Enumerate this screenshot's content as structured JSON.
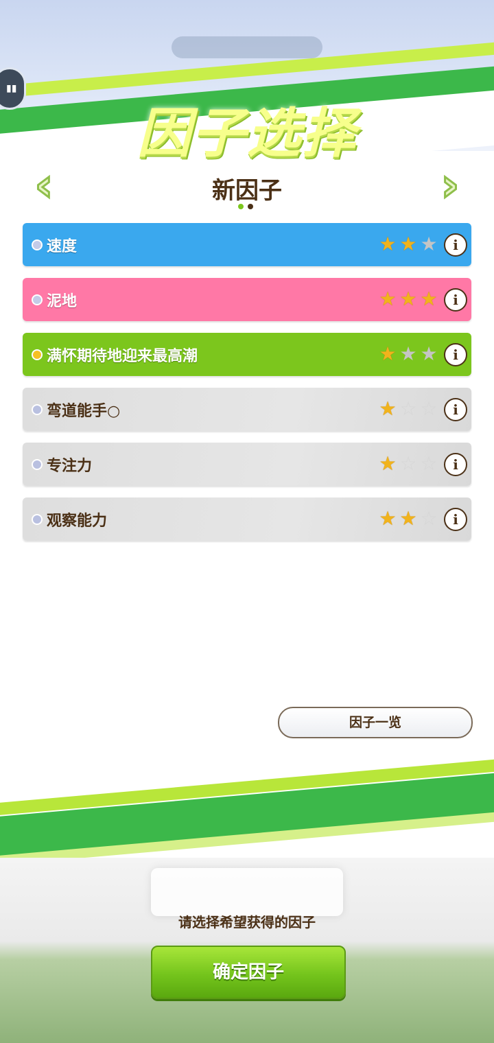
{
  "status_pill": "",
  "header": {
    "title": "因子选择",
    "subtitle": "新因子",
    "prev_arrow": "‹",
    "next_arrow": "›",
    "page_dots": [
      {
        "active": true
      },
      {
        "active": false
      }
    ]
  },
  "colors": {
    "brand_green": "#7cc61d",
    "text_brown": "#4b3016",
    "row_speed": "#3aa8ee",
    "row_dirt": "#ff78a6",
    "row_unique": "#7cc61d",
    "row_skill": "#dedede"
  },
  "factors": [
    {
      "name": "速度",
      "type": "blue",
      "stars": 2,
      "max_stars": 3,
      "bullet": "#c4cbe8",
      "bg": "#3aa8ee",
      "text_color": "#ffffff",
      "empty_style": "solid"
    },
    {
      "name": "泥地",
      "type": "pink",
      "stars": 3,
      "max_stars": 3,
      "bullet": "#c4cbe8",
      "bg": "#ff78a6",
      "text_color": "#ffffff",
      "empty_style": "solid"
    },
    {
      "name": "满怀期待地迎来最高潮",
      "type": "green",
      "stars": 1,
      "max_stars": 3,
      "bullet": "#f6c023",
      "bg": "#7cc61d",
      "text_color": "#ffffff",
      "empty_style": "solid"
    },
    {
      "name": "弯道能手○",
      "type": "white",
      "stars": 1,
      "max_stars": 3,
      "bullet": "#b9c0e0",
      "bg": "#dedede",
      "text_color": "#4b3016",
      "empty_style": "hollow"
    },
    {
      "name": "专注力",
      "type": "white",
      "stars": 1,
      "max_stars": 3,
      "bullet": "#b9c0e0",
      "bg": "#dedede",
      "text_color": "#4b3016",
      "empty_style": "hollow"
    },
    {
      "name": "观察能力",
      "type": "white",
      "stars": 2,
      "max_stars": 3,
      "bullet": "#b9c0e0",
      "bg": "#dedede",
      "text_color": "#4b3016",
      "empty_style": "hollow"
    }
  ],
  "info_glyph": "i",
  "list_button": "因子一览",
  "blurred_label": "",
  "hint": "请选择希望获得的因子",
  "confirm_button": "确定因子"
}
